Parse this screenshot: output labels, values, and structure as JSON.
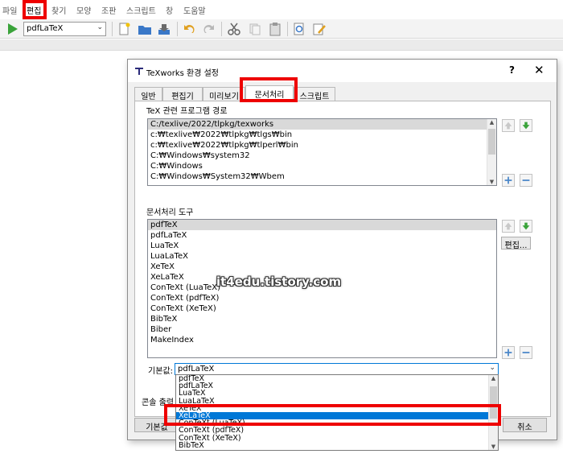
{
  "menu": [
    "파일",
    "편집",
    "찾기",
    "모양",
    "조판",
    "스크립트",
    "창",
    "도움말"
  ],
  "toolbar": {
    "typeset_engine": "pdfLaTeX"
  },
  "dialog": {
    "title": "TeXworks 환경 설정",
    "help_symbol": "?",
    "close_symbol": "✕",
    "tabs": [
      "일반",
      "편집기",
      "미리보기",
      "문서처리",
      "스크립트"
    ],
    "paths_group": {
      "label": "TeX 관련 프로그램 경로",
      "items": [
        "C:/texlive/2022/tlpkg/texworks",
        "c:₩texlive₩2022₩tlpkg₩tlgs₩bin",
        "c:₩texlive₩2022₩tlpkg₩tlperl₩bin",
        "C:₩Windows₩system32",
        "C:₩Windows",
        "C:₩Windows₩System32₩Wbem"
      ]
    },
    "tools_group": {
      "label": "문서처리 도구",
      "items": [
        "pdfTeX",
        "pdfLaTeX",
        "LuaTeX",
        "LuaLaTeX",
        "XeTeX",
        "XeLaTeX",
        "ConTeXt (LuaTeX)",
        "ConTeXt (pdfTeX)",
        "ConTeXt (XeTeX)",
        "BibTeX",
        "Biber",
        "MakeIndex"
      ],
      "edit_button": "편집..."
    },
    "default": {
      "label": "기본값:",
      "value": "pdfLaTeX",
      "dropdown": [
        "pdfTeX",
        "pdfLaTeX",
        "LuaTeX",
        "LuaLaTeX",
        "XeTeX",
        "XeLaTeX",
        "ConTeXt (LuaTeX)",
        "ConTeXt (pdfTeX)",
        "ConTeXt (XeTeX)",
        "BibTeX"
      ]
    },
    "console_label": "콘솔 출력",
    "restore_button": "기본값",
    "cancel_button": "취소"
  },
  "watermark": "it4edu.tistory.com",
  "colors": {
    "highlight_box": "#ee0000",
    "selection": "#0078d7"
  }
}
